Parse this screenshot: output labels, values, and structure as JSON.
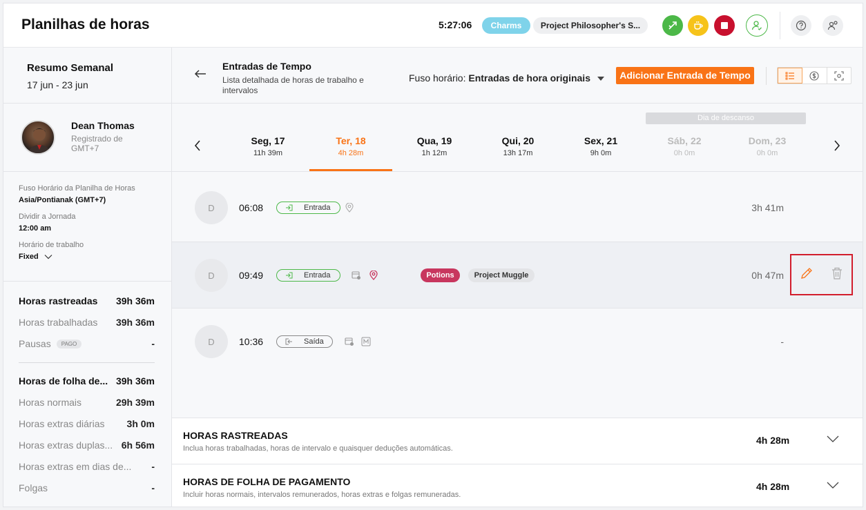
{
  "header": {
    "title": "Planilhas de horas",
    "timer": "5:27:06",
    "activity": "Charms",
    "project": "Project Philosopher's S...",
    "colors": {
      "green": "#4cb848",
      "yellow": "#f6c31a",
      "red": "#c8102e",
      "accent": "#f97316"
    }
  },
  "sidebar": {
    "weekly_title": "Resumo Semanal",
    "weekly_range": "17 jun - 23 jun",
    "person": {
      "name": "Dean Thomas",
      "sub": "Registrado de GMT+7"
    },
    "settings": [
      {
        "label": "Fuso Horário da Planilha de Horas",
        "value": "Asia/Pontianak (GMT+7)"
      },
      {
        "label": "Dividir a Jornada",
        "value": "12:00 am"
      },
      {
        "label": "Horário de trabalho",
        "value": "Fixed"
      }
    ],
    "tracked": [
      {
        "label": "Horas rastreadas",
        "value": "39h 36m"
      },
      {
        "label": "Horas trabalhadas",
        "value": "39h 36m"
      },
      {
        "label": "Pausas",
        "badge": "PAGO",
        "value": "-"
      }
    ],
    "payroll": [
      {
        "label": "Horas de folha de...",
        "value": "39h 36m"
      },
      {
        "label": "Horas normais",
        "value": "29h 39m"
      },
      {
        "label": "Horas extras diárias",
        "value": "3h 0m"
      },
      {
        "label": "Horas extras duplas...",
        "value": "6h 56m"
      },
      {
        "label": "Horas extras em dias de...",
        "value": "-"
      },
      {
        "label": "Folgas",
        "value": "-"
      }
    ]
  },
  "main": {
    "title": "Entradas de Tempo",
    "subtitle": "Lista detalhada de horas de trabalho e intervalos",
    "timezone_label": "Fuso horário:",
    "timezone_value": "Entradas de hora originais",
    "add_button": "Adicionar Entrada de Tempo",
    "rest_day_label": "Dia de descanso",
    "days": [
      {
        "name": "Seg, 17",
        "hours": "11h 39m"
      },
      {
        "name": "Ter, 18",
        "hours": "4h 28m"
      },
      {
        "name": "Qua, 19",
        "hours": "1h 12m"
      },
      {
        "name": "Qui, 20",
        "hours": "13h 17m"
      },
      {
        "name": "Sex, 21",
        "hours": "9h 0m"
      },
      {
        "name": "Sáb, 22",
        "hours": "0h 0m"
      },
      {
        "name": "Dom, 23",
        "hours": "0h 0m"
      }
    ],
    "entries": [
      {
        "avatar": "D",
        "time": "06:08",
        "type": "Entrada",
        "duration": "3h 41m"
      },
      {
        "avatar": "D",
        "time": "09:49",
        "type": "Entrada",
        "activity": "Potions",
        "project": "Project Muggle",
        "duration": "0h 47m"
      },
      {
        "avatar": "D",
        "time": "10:36",
        "type": "Saída",
        "duration": "-"
      }
    ],
    "summaries": [
      {
        "title": "HORAS RASTREADAS",
        "desc": "Inclua horas trabalhadas, horas de intervalo e quaisquer deduções automáticas.",
        "value": "4h 28m"
      },
      {
        "title": "HORAS DE FOLHA DE PAGAMENTO",
        "desc": "Incluir horas normais, intervalos remunerados, horas extras e folgas remuneradas.",
        "value": "4h 28m"
      }
    ]
  }
}
